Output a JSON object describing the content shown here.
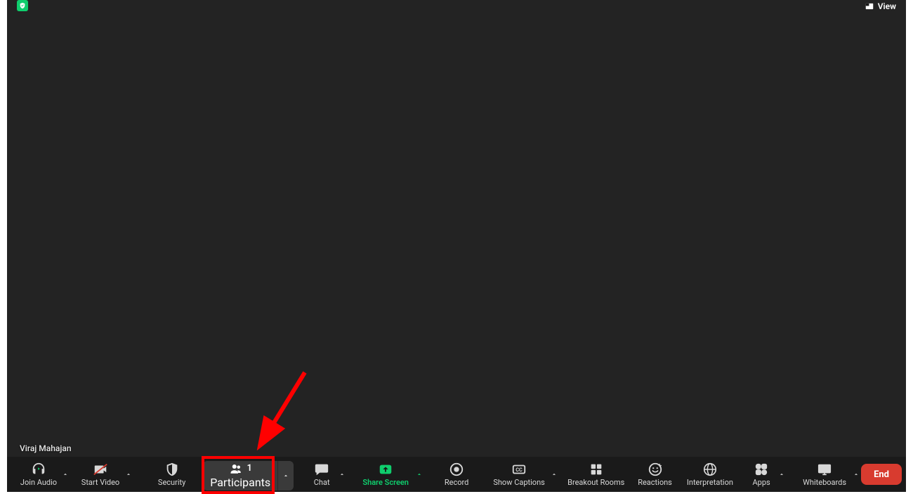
{
  "top": {
    "view_label": "View"
  },
  "video": {
    "participant_name": "Viraj Mahajan"
  },
  "toolbar": {
    "join_audio": "Join Audio",
    "start_video": "Start Video",
    "security": "Security",
    "participants_label": "Participants",
    "participants_count": "1",
    "chat": "Chat",
    "share_screen": "Share Screen",
    "record": "Record",
    "show_captions": "Show Captions",
    "breakout_rooms": "Breakout Rooms",
    "reactions": "Reactions",
    "interpretation": "Interpretation",
    "apps": "Apps",
    "whiteboards": "Whiteboards",
    "end": "End"
  },
  "colors": {
    "accent_green": "#0fce6d",
    "end_red": "#d83b2f",
    "annotation_red": "#ff0000",
    "bg_dark": "#232323",
    "toolbar_dark": "#1a1a1a"
  }
}
